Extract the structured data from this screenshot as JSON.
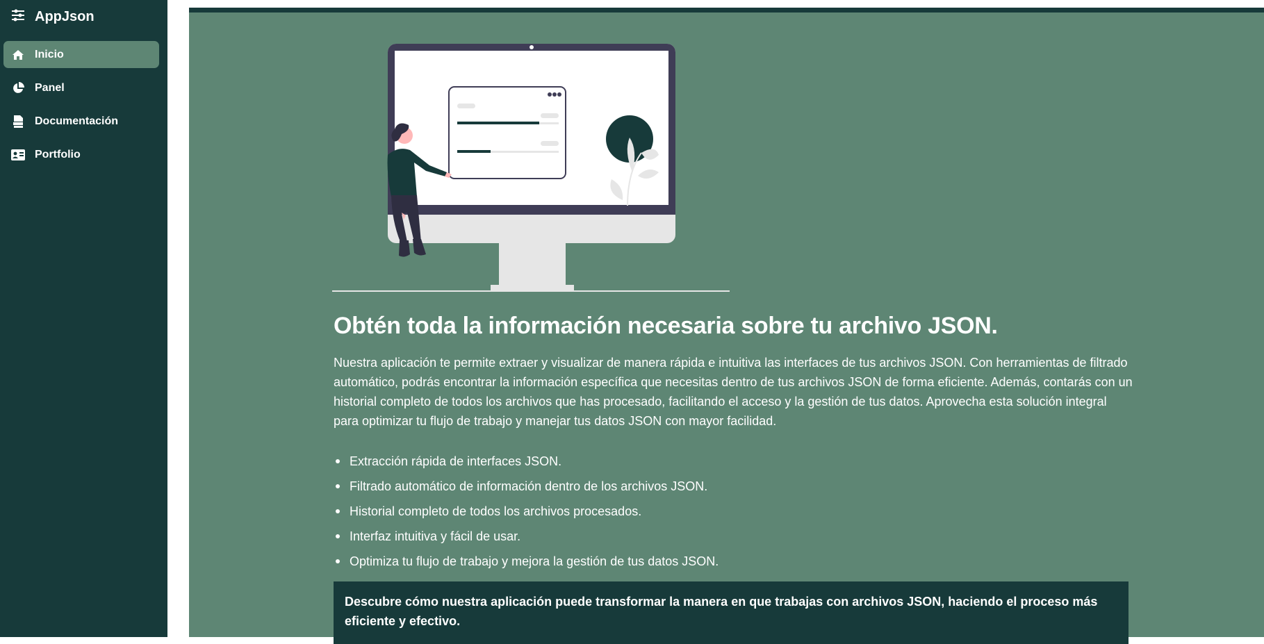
{
  "app": {
    "title": "AppJson",
    "brand_icon": "sliders-icon"
  },
  "sidebar": {
    "items": [
      {
        "label": "Inicio",
        "icon": "home-icon",
        "active": true
      },
      {
        "label": "Panel",
        "icon": "pie-chart-icon",
        "active": false
      },
      {
        "label": "Documentación",
        "icon": "doc-icon",
        "active": false
      },
      {
        "label": "Portfolio",
        "icon": "id-card-icon",
        "active": false
      }
    ]
  },
  "main": {
    "headline": "Obtén toda la información necesaria sobre tu archivo JSON.",
    "intro": "Nuestra aplicación te permite extraer y visualizar de manera rápida e intuitiva las interfaces de tus archivos JSON. Con herramientas de filtrado automático, podrás encontrar la información específica que necesitas dentro de tus archivos JSON de forma eficiente. Además, contarás con un historial completo de todos los archivos que has procesado, facilitando el acceso y la gestión de tus datos. Aprovecha esta solución integral para optimizar tu flujo de trabajo y manejar tus datos JSON con mayor facilidad.",
    "features": [
      "Extracción rápida de interfaces JSON.",
      "Filtrado automático de información dentro de los archivos JSON.",
      "Historial completo de todos los archivos procesados.",
      "Interfaz intuitiva y fácil de usar.",
      "Optimiza tu flujo de trabajo y mejora la gestión de tus datos JSON."
    ],
    "cta": "Descubre cómo nuestra aplicación puede transformar la manera en que trabajas con archivos JSON, haciendo el proceso más eficiente y efectivo."
  },
  "colors": {
    "sidebar_bg": "#173a3a",
    "content_bg": "#5e8674",
    "active_item_bg": "#5e8674",
    "cta_bg": "#173a3a"
  }
}
